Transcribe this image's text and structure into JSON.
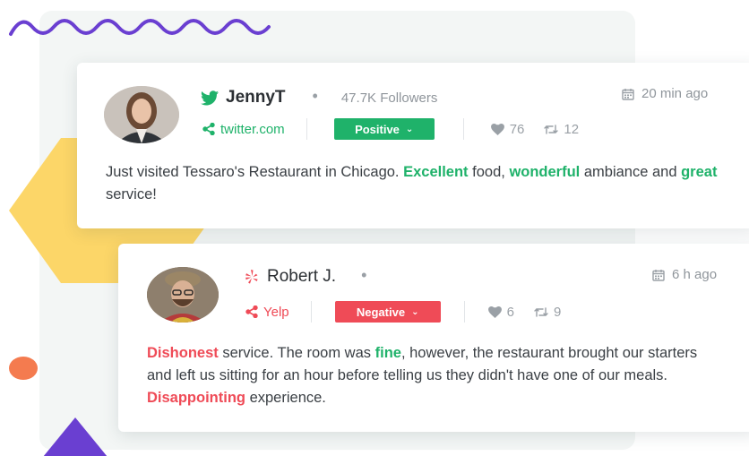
{
  "colors": {
    "positive": "#1fb26a",
    "negative": "#ef4b57",
    "twitter": "#1fb26a",
    "yelp": "#ef4b57",
    "wave": "#6a3fd1",
    "hexagon": "#fcd668",
    "orange_dot": "#f47b4f",
    "triangle": "#6a3fd1"
  },
  "reviews": [
    {
      "platform_icon": "twitter-bird-icon",
      "username": "JennyT",
      "followers": "47.7K Followers",
      "time": "20 min ago",
      "source_icon": "share-icon",
      "source": "twitter.com",
      "sentiment": "Positive",
      "likes": "76",
      "retweets": "12",
      "text": [
        {
          "t": "Just visited Tessaro's Restaurant in Chicago. ",
          "hl": ""
        },
        {
          "t": "Excellent",
          "hl": "pos"
        },
        {
          "t": " food, ",
          "hl": ""
        },
        {
          "t": "wonderful",
          "hl": "pos"
        },
        {
          "t": " ambiance and ",
          "hl": ""
        },
        {
          "t": "great",
          "hl": "pos"
        },
        {
          "t": " service!",
          "hl": ""
        }
      ]
    },
    {
      "platform_icon": "yelp-icon",
      "username": "Robert J.",
      "time": "6 h ago",
      "source_icon": "share-icon",
      "source": "Yelp",
      "sentiment": "Negative",
      "likes": "6",
      "retweets": "9",
      "text": [
        {
          "t": "Dishonest",
          "hl": "neg"
        },
        {
          "t": " service. The room was ",
          "hl": ""
        },
        {
          "t": "fine",
          "hl": "pos"
        },
        {
          "t": ", however, the restaurant brought our starters and left us sitting for an hour before telling us they didn't have one of our meals. ",
          "hl": ""
        },
        {
          "t": "Disappointing",
          "hl": "neg"
        },
        {
          "t": " experience.",
          "hl": ""
        }
      ]
    }
  ]
}
